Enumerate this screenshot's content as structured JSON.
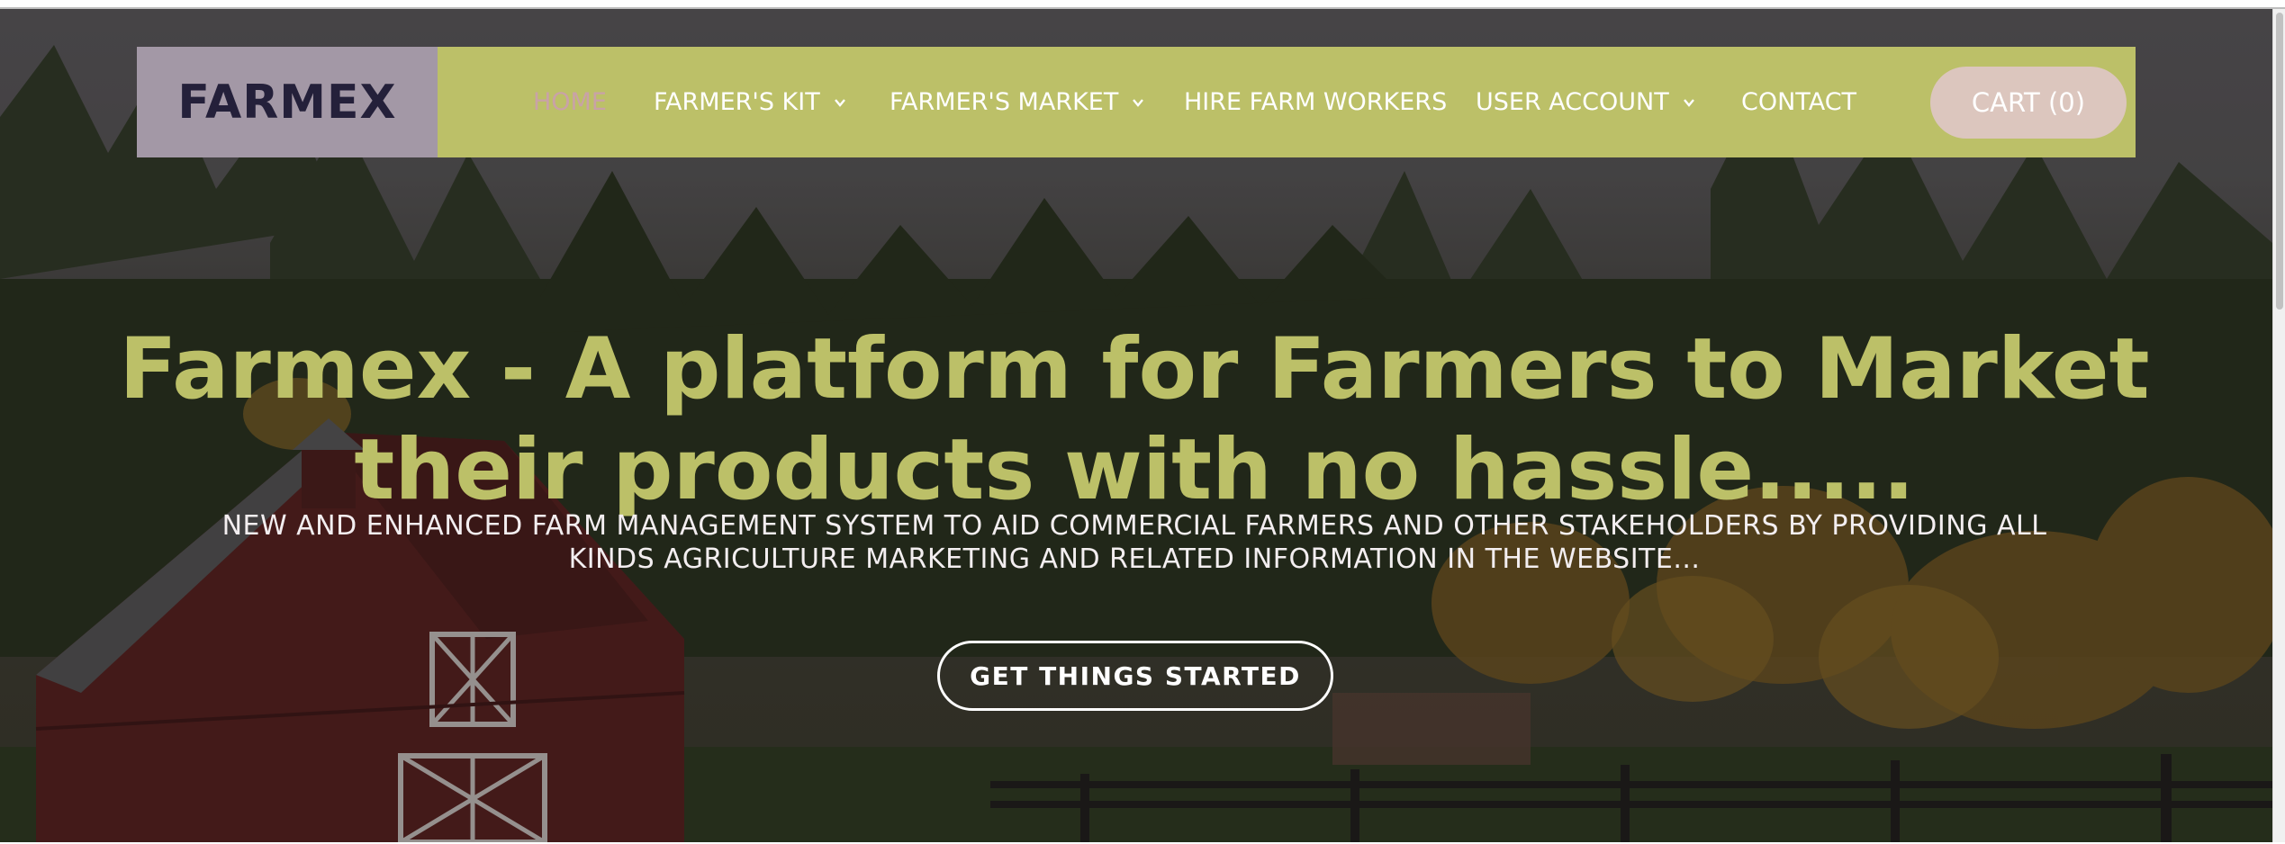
{
  "brand": {
    "name": "FARMEX"
  },
  "nav": {
    "items": [
      {
        "label": "HOME",
        "active": true,
        "has_dropdown": false
      },
      {
        "label": "FARMER'S KIT",
        "active": false,
        "has_dropdown": true
      },
      {
        "label": "FARMER'S MARKET",
        "active": false,
        "has_dropdown": true
      },
      {
        "label": "HIRE FARM WORKERS",
        "active": false,
        "has_dropdown": false
      },
      {
        "label": "USER ACCOUNT",
        "active": false,
        "has_dropdown": true
      },
      {
        "label": "CONTACT",
        "active": false,
        "has_dropdown": false
      }
    ],
    "cart_label": "CART (0)"
  },
  "hero": {
    "headline": "Farmex - A platform for Farmers to Market their products with no hassle.....",
    "subtext": "NEW AND ENHANCED FARM MANAGEMENT SYSTEM TO AID COMMERCIAL FARMERS AND OTHER STAKEHOLDERS BY PROVIDING ALL KINDS AGRICULTURE MARKETING AND RELATED INFORMATION IN THE WEBSITE...",
    "cta_label": "GET THINGS STARTED"
  },
  "colors": {
    "navbar_bg": "#bcc068",
    "brand_bg": "#a398a6",
    "brand_text": "#24203a",
    "active_link": "#c9a2a7",
    "cart_bg": "#dcc6be",
    "headline": "#bcc068"
  },
  "icons": {
    "dropdown": "chevron-down-icon"
  }
}
